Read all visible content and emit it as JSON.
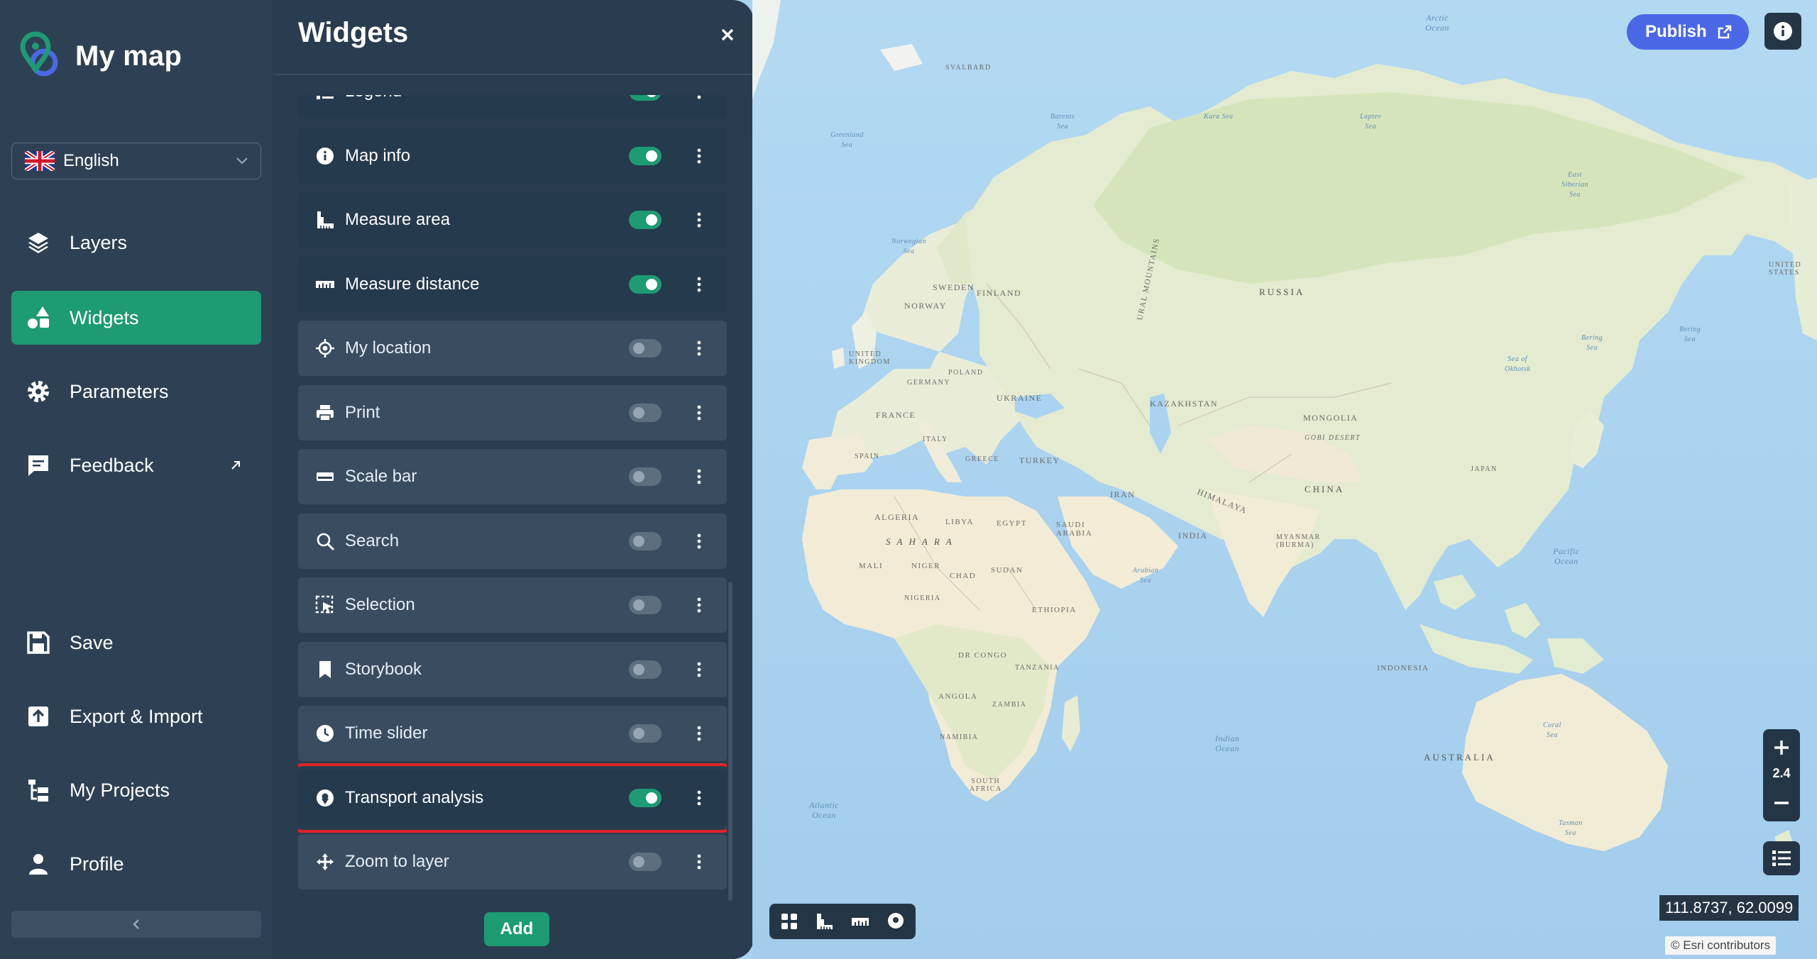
{
  "app": {
    "title": "My map"
  },
  "language": {
    "selected": "English"
  },
  "nav": {
    "layers": "Layers",
    "widgets": "Widgets",
    "parameters": "Parameters",
    "feedback": "Feedback",
    "save": "Save",
    "export_import": "Export & Import",
    "my_projects": "My Projects",
    "profile": "Profile"
  },
  "panel": {
    "title": "Widgets",
    "add_label": "Add",
    "widgets": [
      {
        "label": "Legend",
        "enabled": true,
        "icon": "list-icon"
      },
      {
        "label": "Map info",
        "enabled": true,
        "icon": "info-icon"
      },
      {
        "label": "Measure area",
        "enabled": true,
        "icon": "measure-area-icon"
      },
      {
        "label": "Measure distance",
        "enabled": true,
        "icon": "ruler-icon"
      },
      {
        "label": "My location",
        "enabled": false,
        "icon": "crosshair-icon"
      },
      {
        "label": "Print",
        "enabled": false,
        "icon": "printer-icon"
      },
      {
        "label": "Scale bar",
        "enabled": false,
        "icon": "scale-bar-icon"
      },
      {
        "label": "Search",
        "enabled": false,
        "icon": "search-icon"
      },
      {
        "label": "Selection",
        "enabled": false,
        "icon": "selection-icon"
      },
      {
        "label": "Storybook",
        "enabled": false,
        "icon": "bookmark-icon"
      },
      {
        "label": "Time slider",
        "enabled": false,
        "icon": "clock-icon"
      },
      {
        "label": "Transport analysis",
        "enabled": true,
        "icon": "location-pin-icon",
        "highlighted": true
      },
      {
        "label": "Zoom to layer",
        "enabled": false,
        "icon": "move-arrows-icon"
      }
    ]
  },
  "map": {
    "publish_label": "Publish",
    "zoom_level": "2.4",
    "coordinates": "111.8737, 62.0099",
    "attribution": "© Esri contributors",
    "labels": {
      "arctic": "Arctic\nOcean",
      "svalbard": "SVALBARD",
      "greenland_sea": "Greenland\nSea",
      "barents": "Barents\nSea",
      "kara": "Kara Sea",
      "laptev": "Laptev\nSea",
      "norwegian": "Norwegian\nSea",
      "east_siberian": "East\nSiberian\nSea",
      "sweden": "SWEDEN",
      "finland": "FINLAND",
      "norway": "NORWAY",
      "russia": "RUSSIA",
      "united_kingdom": "UNITED\nKINGDOM",
      "germany": "GERMANY",
      "poland": "POLAND",
      "ukraine": "UKRAINE",
      "france": "FRANCE",
      "italy": "ITALY",
      "spain": "SPAIN",
      "greece": "GREECE",
      "turkey": "TURKEY",
      "ural": "URAL MOUNTAINS",
      "kazakhstan": "KAZAKHSTAN",
      "mongolia": "MONGOLIA",
      "gobi": "GOBI DESERT",
      "china": "CHINA",
      "japan": "JAPAN",
      "iran": "IRAN",
      "himalaya": "HIMALAYA",
      "india": "INDIA",
      "myanmar": "MYANMAR\n(BURMA)",
      "algeria": "ALGERIA",
      "libya": "LIBYA",
      "egypt": "EGYPT",
      "saudi": "SAUDI\nARABIA",
      "sahara": "S A H A R A",
      "mali": "MALI",
      "niger": "NIGER",
      "chad": "CHAD",
      "sudan": "SUDAN",
      "nigeria": "NIGERIA",
      "ethiopia": "ETHIOPIA",
      "dr_congo": "DR CONGO",
      "tanzania": "TANZANIA",
      "angola": "ANGOLA",
      "zambia": "ZAMBIA",
      "namibia": "NAMIBIA",
      "south_africa": "SOUTH\nAFRICA",
      "arabian_sea": "Arabian\nSea",
      "indian_ocean": "Indian\nOcean",
      "atlantic": "Atlantic\nOcean",
      "pacific": "Pacific\nOcean",
      "indonesia": "INDONESIA",
      "australia": "AUSTRALIA",
      "coral": "Coral\nSea",
      "tasman": "Tasman\nSea",
      "okhotsk": "Sea of\nOkhotsk",
      "bering": "Bering\nSea",
      "beringb": "Bering\nSea",
      "united_states": "UNITED\nSTATES"
    }
  }
}
